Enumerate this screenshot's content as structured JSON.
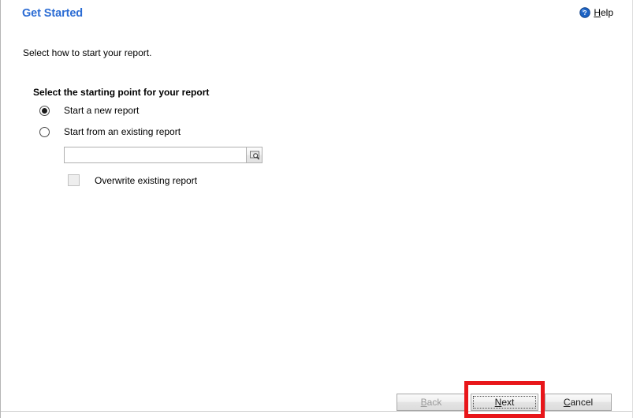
{
  "header": {
    "title": "Get Started",
    "help": {
      "label_prefix": "",
      "accesskey": "H",
      "label_rest": "elp",
      "icon": "help-circle-icon",
      "icon_color": "#1b62c4"
    }
  },
  "intro": {
    "text": "Select how to start your report."
  },
  "group": {
    "heading": "Select the starting point for your report",
    "options": [
      {
        "label": "Start a new report",
        "selected": true
      },
      {
        "label": "Start from an existing report",
        "selected": false
      }
    ]
  },
  "existing_report": {
    "input_value": "",
    "input_placeholder": "",
    "browse_icon": "browse-folder-magnifier-icon"
  },
  "overwrite": {
    "label": "Overwrite existing report",
    "checked": false,
    "disabled": true
  },
  "footer": {
    "buttons": [
      {
        "name": "back",
        "accesskey": "B",
        "label_rest": "ack",
        "disabled": true
      },
      {
        "name": "next",
        "accesskey": "N",
        "label_rest": "ext",
        "disabled": false,
        "focused": true
      },
      {
        "name": "cancel",
        "accesskey": "C",
        "label_rest": "ancel",
        "disabled": false
      }
    ]
  },
  "annotation": {
    "color": "#e8161a",
    "target": "next-button"
  },
  "colors": {
    "title_blue": "#2b6cd4",
    "text_black": "#000000",
    "disabled_gray": "#9a9a9a",
    "annotation_red": "#e8161a"
  }
}
